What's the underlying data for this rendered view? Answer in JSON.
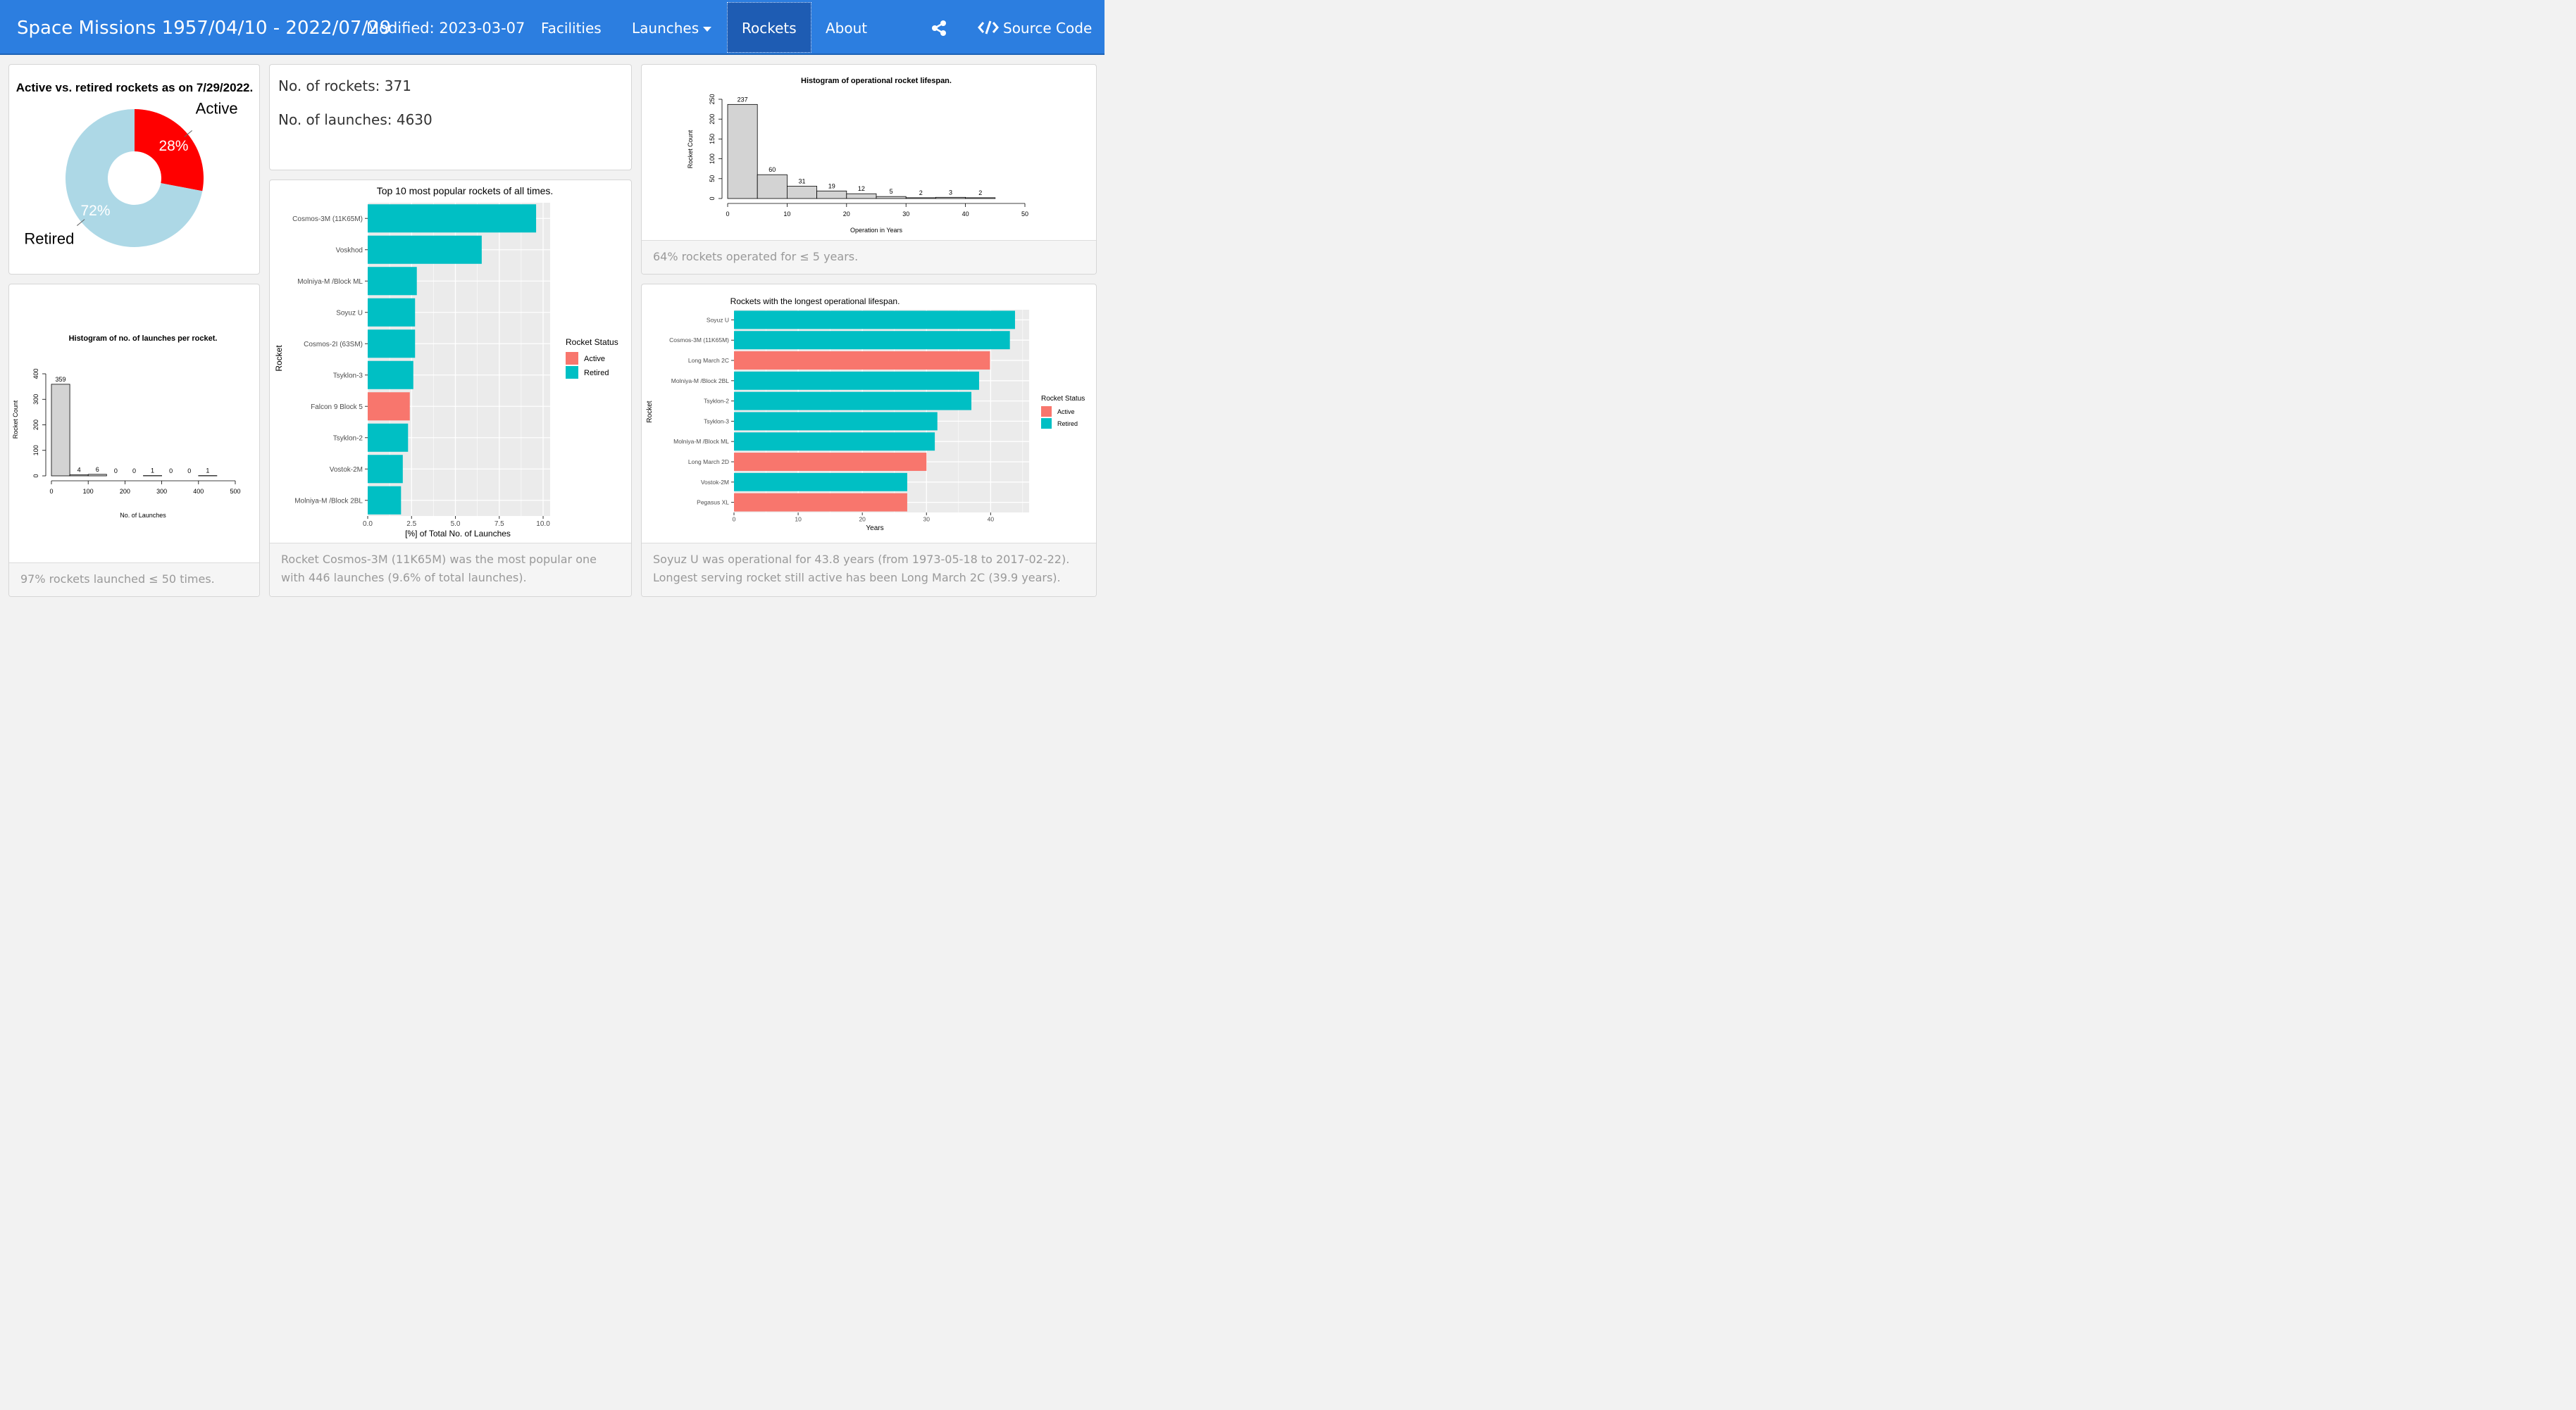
{
  "navbar": {
    "title": "Space Missions 1957/04/10 - 2022/07/29",
    "modified": "Modified: 2023-03-07",
    "links": {
      "facilities": "Facilities",
      "launches": "Launches",
      "rockets": "Rockets",
      "about": "About",
      "source_code": "Source Code"
    },
    "active_link": "Rockets",
    "share_icon": "share-icon",
    "code_icon": "code-icon"
  },
  "colors": {
    "navbar": "#2c7ee0",
    "active": "#ff0000",
    "retired_pie": "#add8e6",
    "ggplot_active": "#f8766d",
    "ggplot_retired": "#00bfc4",
    "hist_bar": "#d3d3d3"
  },
  "stats": {
    "rockets": "No. of rockets: 371",
    "launches": "No. of launches: 4630"
  },
  "footers": {
    "launches_hist": "97% rockets launched ≤ 50 times.",
    "popular": "Rocket Cosmos-3M (11K65M) was the most popular one with 446 launches (9.6% of total launches).",
    "lifespan_hist": "64% rockets operated for ≤ 5 years.",
    "longest_line1": "Soyuz U was operational for 43.8 years (from 1973-05-18 to 2017-02-22).",
    "longest_line2": "Longest serving rocket still active has been Long March 2C (39.9 years)."
  },
  "chart_data": [
    {
      "type": "pie",
      "title": "Active vs. retired rockets as on 7/29/2022.",
      "categories": [
        "Active",
        "Retired"
      ],
      "values": [
        28,
        72
      ],
      "value_labels": [
        "28%",
        "72%"
      ],
      "donut": true
    },
    {
      "type": "bar",
      "title": "Histogram of no. of launches per rocket.",
      "xlabel": "No. of Launches",
      "ylabel": "Rocket Count",
      "bins": [
        [
          0,
          50
        ],
        [
          50,
          100
        ],
        [
          100,
          150
        ],
        [
          150,
          200
        ],
        [
          200,
          250
        ],
        [
          250,
          300
        ],
        [
          300,
          350
        ],
        [
          350,
          400
        ],
        [
          400,
          450
        ]
      ],
      "values": [
        359,
        4,
        6,
        0,
        0,
        1,
        0,
        0,
        1
      ],
      "xlim": [
        0,
        500
      ],
      "ylim": [
        0,
        400
      ],
      "xticks": [
        0,
        100,
        200,
        300,
        400,
        500
      ],
      "yticks": [
        0,
        100,
        200,
        300,
        400
      ]
    },
    {
      "type": "bar",
      "orientation": "horizontal",
      "title": "Top 10 most popular rockets of all times.",
      "xlabel": "[%] of Total No. of Launches",
      "ylabel": "Rocket",
      "categories": [
        "Cosmos-3M (11K65M)",
        "Voskhod",
        "Molniya-M /Block ML",
        "Soyuz U",
        "Cosmos-2I (63SM)",
        "Tsyklon-3",
        "Falcon 9 Block 5",
        "Tsyklon-2",
        "Vostok-2M",
        "Molniya-M /Block 2BL"
      ],
      "values": [
        9.6,
        6.5,
        2.8,
        2.7,
        2.7,
        2.6,
        2.4,
        2.3,
        2.0,
        1.9
      ],
      "status": [
        "Retired",
        "Retired",
        "Retired",
        "Retired",
        "Retired",
        "Retired",
        "Active",
        "Retired",
        "Retired",
        "Retired"
      ],
      "xlim": [
        0,
        10.4
      ],
      "xticks": [
        "0.0",
        "2.5",
        "5.0",
        "7.5",
        "10.0"
      ],
      "legend": {
        "title": "Rocket Status",
        "entries": [
          "Active",
          "Retired"
        ],
        "position": "right"
      }
    },
    {
      "type": "bar",
      "title": "Histogram of operational rocket lifespan.",
      "xlabel": "Operation in Years",
      "ylabel": "Rocket Count",
      "bins": [
        [
          0,
          5
        ],
        [
          5,
          10
        ],
        [
          10,
          15
        ],
        [
          15,
          20
        ],
        [
          20,
          25
        ],
        [
          25,
          30
        ],
        [
          30,
          35
        ],
        [
          35,
          40
        ],
        [
          40,
          45
        ]
      ],
      "values": [
        237,
        60,
        31,
        19,
        12,
        5,
        2,
        3,
        2
      ],
      "xlim": [
        0,
        50
      ],
      "ylim": [
        0,
        250
      ],
      "xticks": [
        0,
        10,
        20,
        30,
        40,
        50
      ],
      "yticks": [
        0,
        50,
        100,
        150,
        200,
        250
      ]
    },
    {
      "type": "bar",
      "orientation": "horizontal",
      "title": "Rockets with the longest operational lifespan.",
      "xlabel": "Years",
      "ylabel": "Rocket",
      "categories": [
        "Soyuz U",
        "Cosmos-3M (11K65M)",
        "Long March 2C",
        "Molniya-M /Block 2BL",
        "Tsyklon-2",
        "Tsyklon-3",
        "Molniya-M /Block ML",
        "Long March 2D",
        "Vostok-2M",
        "Pegasus XL"
      ],
      "values": [
        43.8,
        43.0,
        39.9,
        38.2,
        37.0,
        31.7,
        31.3,
        30.0,
        27.0,
        27.0
      ],
      "status": [
        "Retired",
        "Retired",
        "Active",
        "Retired",
        "Retired",
        "Retired",
        "Retired",
        "Active",
        "Retired",
        "Active"
      ],
      "xlim": [
        0,
        46
      ],
      "xticks": [
        "0",
        "10",
        "20",
        "30",
        "40"
      ],
      "legend": {
        "title": "Rocket Status",
        "entries": [
          "Active",
          "Retired"
        ],
        "position": "right"
      }
    }
  ]
}
